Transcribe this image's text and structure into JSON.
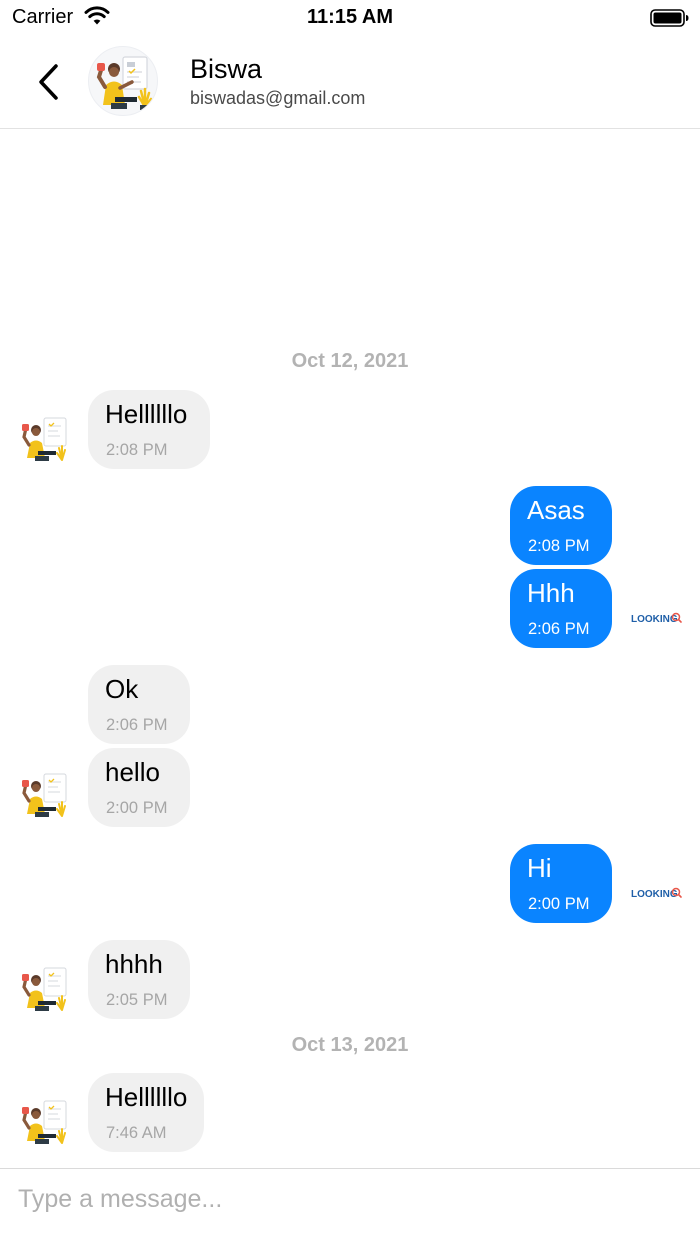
{
  "status_bar": {
    "carrier": "Carrier",
    "time": "11:15 AM"
  },
  "header": {
    "name": "Biswa",
    "email": "biswadas@gmail.com"
  },
  "composer": {
    "placeholder": "Type a message..."
  },
  "app_logo_text": "LOOKING",
  "thread": [
    {
      "kind": "date",
      "label": "Oct 12, 2021"
    },
    {
      "kind": "message",
      "direction": "in",
      "text": "Hellllllo",
      "time": "2:08 PM"
    },
    {
      "kind": "message",
      "direction": "out",
      "text": "Asas",
      "time": "2:08 PM"
    },
    {
      "kind": "message",
      "direction": "out",
      "text": "Hhh",
      "time": "2:06 PM"
    },
    {
      "kind": "message",
      "direction": "in",
      "text": "Ok",
      "time": "2:06 PM"
    },
    {
      "kind": "message",
      "direction": "in",
      "text": "hello",
      "time": "2:00 PM"
    },
    {
      "kind": "message",
      "direction": "out",
      "text": "Hi",
      "time": "2:00 PM"
    },
    {
      "kind": "message",
      "direction": "in",
      "text": "hhhh",
      "time": "2:05 PM"
    },
    {
      "kind": "date",
      "label": "Oct 13, 2021"
    },
    {
      "kind": "message",
      "direction": "in",
      "text": "Hellllllo",
      "time": "7:46 AM"
    }
  ],
  "colors": {
    "outgoing_bubble": "#0a84ff",
    "incoming_bubble": "#f0f0f0",
    "date_label": "#b3b3b3"
  }
}
